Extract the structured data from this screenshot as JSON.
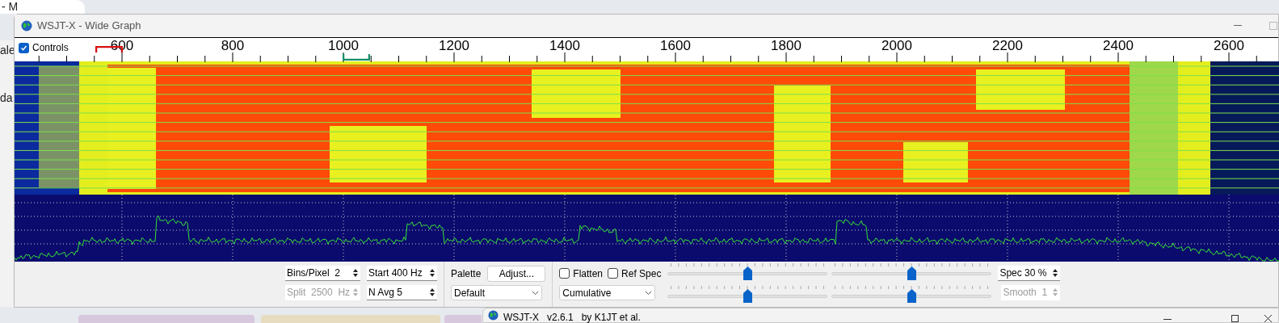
{
  "background": {
    "tab_text": "- M",
    "side_texts": [
      "ale",
      "da"
    ]
  },
  "window": {
    "title": "WSJT-X - Wide Graph"
  },
  "controls_toggle": {
    "label": "Controls",
    "checked": true
  },
  "ruler": {
    "labels": [
      "600",
      "800",
      "1000",
      "1200",
      "1400",
      "1600",
      "1800",
      "2000",
      "2200",
      "2400",
      "2600"
    ]
  },
  "controls": {
    "bins_per_pixel": {
      "text": "Bins/Pixel  2",
      "disabled": false
    },
    "start": {
      "text": "Start 400 Hz",
      "disabled": false
    },
    "split": {
      "text": "Split  2500  Hz",
      "disabled": true
    },
    "n_avg": {
      "text": "N Avg 5",
      "disabled": false
    },
    "palette_label": "Palette",
    "adjust_button": "Adjust...",
    "palette_combo": "Default",
    "flatten": {
      "label": "Flatten",
      "checked": false
    },
    "ref_spec": {
      "label": "Ref Spec",
      "checked": false
    },
    "spectrum_combo": "Cumulative",
    "sliders": [
      {
        "level": 0.5
      },
      {
        "level": 0.5
      },
      {
        "level": 0.5
      },
      {
        "level": 0.5
      }
    ],
    "spec": {
      "text": "Spec 30 %",
      "disabled": false
    },
    "smooth": {
      "text": "Smooth  1",
      "disabled": true
    }
  },
  "taskbar_window": {
    "title": "WSJT-X   v2.6.1   by K1JT et al."
  }
}
